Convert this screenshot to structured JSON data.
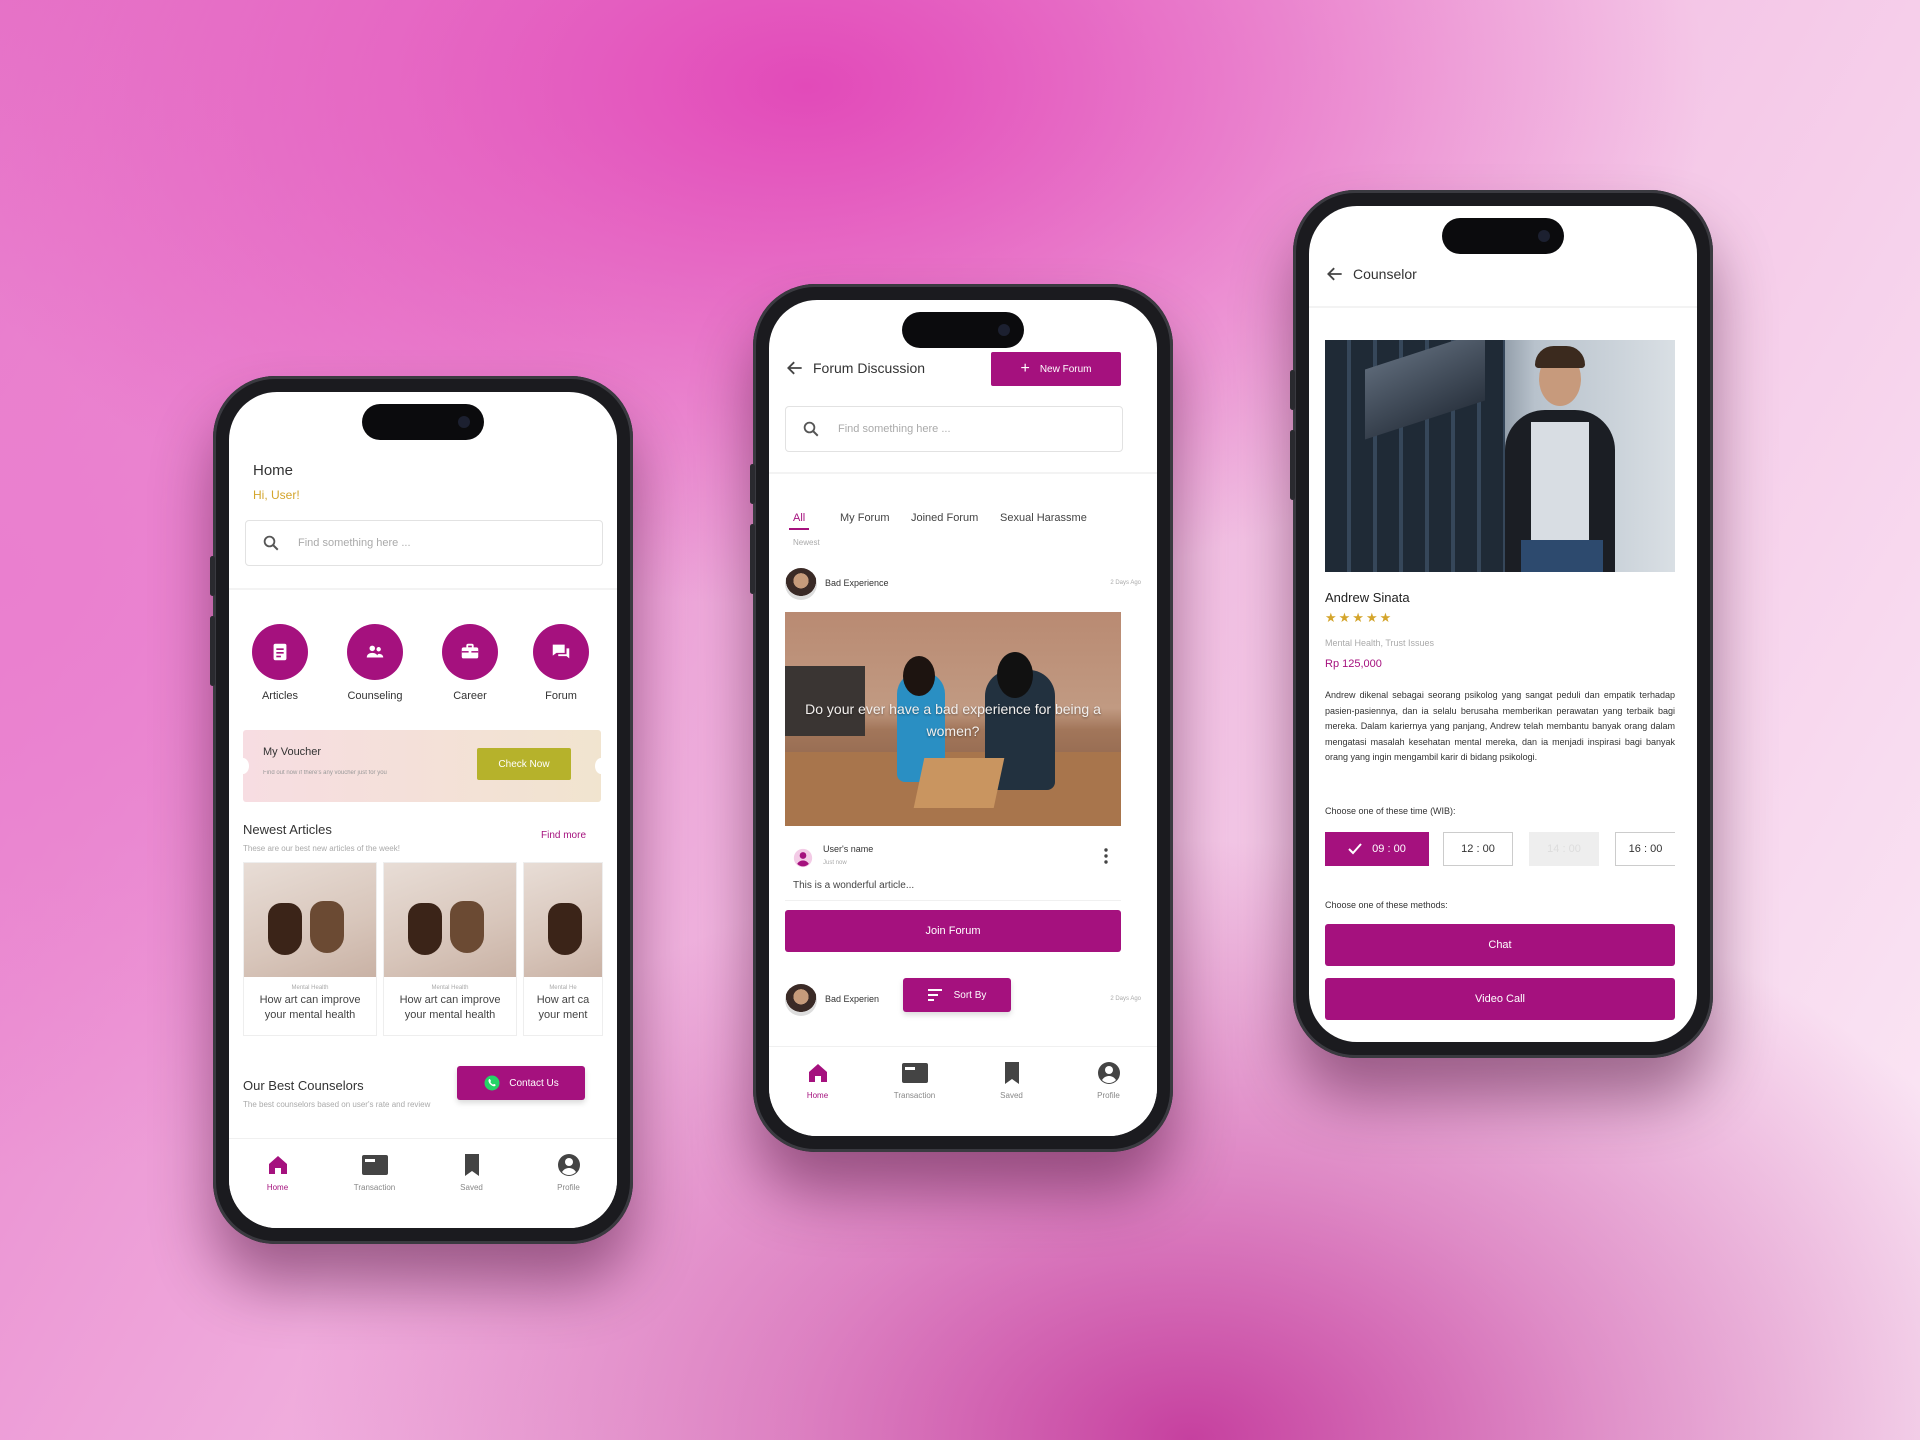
{
  "colors": {
    "primary": "#a5117e",
    "accent_gold": "#d4a52c",
    "voucher_button": "#b6b22b",
    "whatsapp": "#25d366"
  },
  "home": {
    "title": "Home",
    "greeting": "Hi, User!",
    "search_placeholder": "Find something here ...",
    "categories": [
      {
        "label": "Articles",
        "icon": "article-icon"
      },
      {
        "label": "Counseling",
        "icon": "people-icon"
      },
      {
        "label": "Career",
        "icon": "briefcase-icon"
      },
      {
        "label": "Forum",
        "icon": "chat-icon"
      }
    ],
    "voucher": {
      "title": "My Voucher",
      "subtitle": "Find out now if there's any voucher just for you",
      "button": "Check Now"
    },
    "newest_articles": {
      "title": "Newest Articles",
      "subtitle": "These are our best new articles of the week!",
      "link": "Find more",
      "items": [
        {
          "category": "Mental Health",
          "title_line1": "How art can improve",
          "title_line2": "your mental health"
        },
        {
          "category": "Mental Health",
          "title_line1": "How art can improve",
          "title_line2": "your mental health"
        },
        {
          "category": "Mental He",
          "title_line1": "How art ca",
          "title_line2": "your ment"
        }
      ]
    },
    "counselors": {
      "title": "Our Best Counselors",
      "subtitle": "The best counselors based on user's rate and review"
    },
    "contact_button": "Contact Us"
  },
  "forum": {
    "title": "Forum Discussion",
    "new_forum_button": "New Forum",
    "search_placeholder": "Find something here ...",
    "tabs": [
      "All",
      "My Forum",
      "Joined Forum",
      "Sexual Harassme"
    ],
    "section_label": "Newest",
    "post": {
      "title": "Bad Experience",
      "time": "2 Days Ago",
      "image_caption": "Do your ever have a bad experience for being a women?",
      "comment_user": "User's name",
      "comment_meta": "Just now",
      "comment_text": "This is a wonderful article...",
      "join_button": "Join Forum"
    },
    "post2": {
      "title": "Bad Experien",
      "time": "2 Days Ago"
    },
    "sort_button": "Sort By"
  },
  "counselor": {
    "title": "Counselor",
    "name": "Andrew Sinata",
    "rating": 5,
    "stars": "★★★★★",
    "specialties": "Mental Health, Trust Issues",
    "price": "Rp 125,000",
    "bio": "Andrew dikenal sebagai seorang psikolog yang sangat peduli dan empatik terhadap pasien-pasiennya, dan ia selalu berusaha memberikan perawatan yang terbaik bagi mereka. Dalam kariernya yang panjang, Andrew telah membantu banyak orang dalam mengatasi masalah kesehatan mental mereka, dan ia menjadi inspirasi bagi banyak orang yang ingin mengambil karir di bidang psikologi.",
    "time_label": "Choose one of these time (WIB):",
    "times": [
      "09 : 00",
      "12 : 00",
      "14 : 00",
      "16 : 00"
    ],
    "method_label": "Choose one of these methods:",
    "chat_button": "Chat",
    "video_button": "Video Call"
  },
  "nav": [
    "Home",
    "Transaction",
    "Saved",
    "Profile"
  ]
}
